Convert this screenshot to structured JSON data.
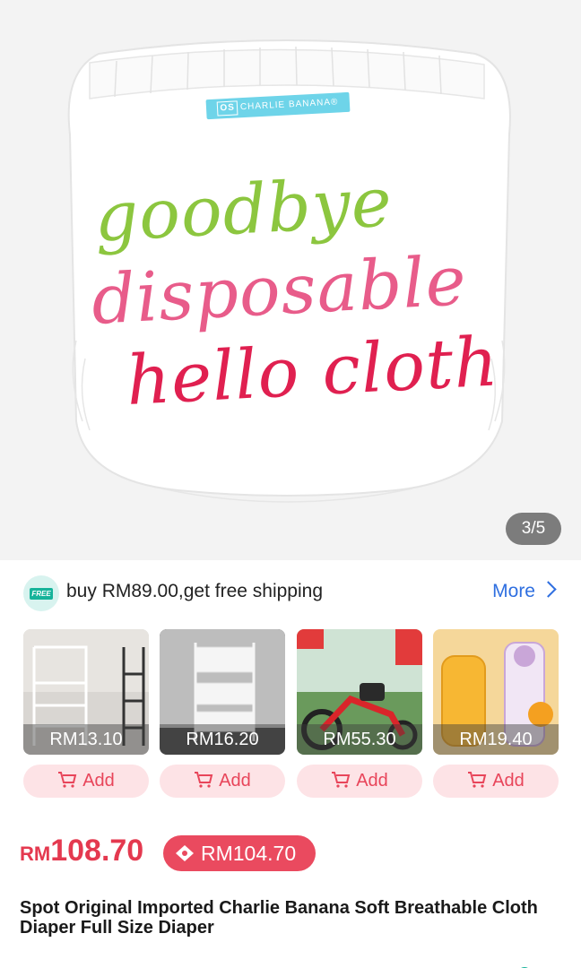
{
  "hero": {
    "brand_tag_os": "OS",
    "brand_tag_text": "CHARLIE BANANA®",
    "slogan_line1": "goodbye",
    "slogan_line2": "disposable",
    "slogan_line3": "hello cloth",
    "page_indicator": "3/5"
  },
  "shipping": {
    "icon_tag": "FREE",
    "text": "buy RM89.00,get free shipping",
    "more_label": "More"
  },
  "products": [
    {
      "price": "RM13.10",
      "add_label": "Add",
      "icon": "clothes-rack-image"
    },
    {
      "price": "RM16.20",
      "add_label": "Add",
      "icon": "storage-cart-image"
    },
    {
      "price": "RM55.30",
      "add_label": "Add",
      "icon": "tricycle-image"
    },
    {
      "price": "RM19.40",
      "add_label": "Add",
      "icon": "water-bottle-image"
    }
  ],
  "price": {
    "currency": "RM",
    "amount": "108.70",
    "coupon_price": "RM104.70"
  },
  "product_title": "Spot Original Imported Charlie Banana Soft Breathable Cloth Diaper Full Size Diaper",
  "colors": {
    "accent_red": "#e4394f",
    "link_blue": "#2f6fe0",
    "free_green": "#16b39a"
  }
}
